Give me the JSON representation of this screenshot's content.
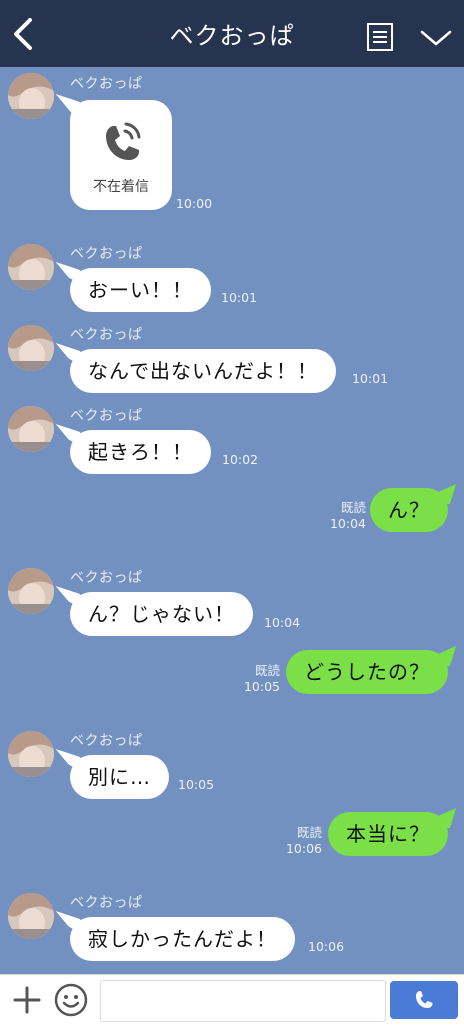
{
  "header": {
    "title": "ベクおっぱ"
  },
  "missed_call": {
    "sender": "ベクおっぱ",
    "label": "不在着信",
    "time": "10:00"
  },
  "messages": [
    {
      "sender": "ベクおっぱ",
      "text": "おーい！！",
      "time": "10:01"
    },
    {
      "sender": "ベクおっぱ",
      "text": "なんで出ないんだよ！！",
      "time": "10:01"
    },
    {
      "sender": "ベクおっぱ",
      "text": "起きろ！！",
      "time": "10:02"
    },
    {
      "read": "既読",
      "text": "ん？",
      "time": "10:04"
    },
    {
      "sender": "ベクおっぱ",
      "text": "ん？じゃない！",
      "time": "10:04"
    },
    {
      "read": "既読",
      "text": "どうしたの？",
      "time": "10:05"
    },
    {
      "sender": "ベクおっぱ",
      "text": "別に…",
      "time": "10:05"
    },
    {
      "read": "既読",
      "text": "本当に？",
      "time": "10:06"
    },
    {
      "sender": "ベクおっぱ",
      "text": "寂しかったんだよ！",
      "time": "10:06"
    }
  ],
  "input": {
    "value": ""
  },
  "icons": {
    "back": "chevron-left-icon",
    "menu": "menu-list-icon",
    "more": "chevron-down-icon",
    "missed_call": "phone-icon",
    "add": "plus-icon",
    "sticker": "smiley-icon",
    "call": "phone-icon"
  },
  "colors": {
    "header": "#263450",
    "background": "#7291c1",
    "sent_bubble": "#7be047",
    "call_button": "#4a7bd6"
  }
}
